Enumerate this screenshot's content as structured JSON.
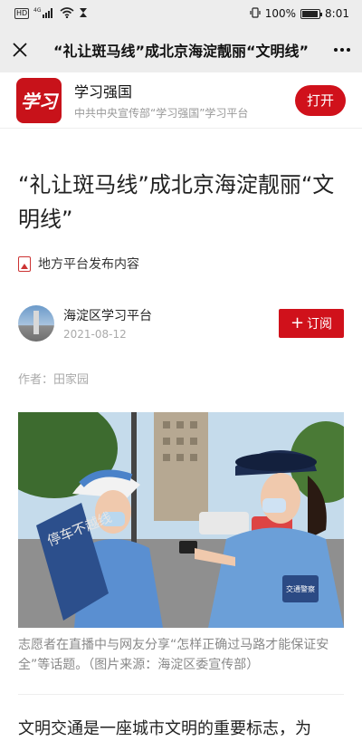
{
  "status_bar": {
    "left_badge": "HD",
    "signal_badge": "4G",
    "battery_percent": "100%",
    "time": "8:01"
  },
  "title_bar": {
    "title": "“礼让斑马线”成北京海淀靓丽“文明线”",
    "close_icon": "close-icon",
    "more_icon": "more-icon"
  },
  "app_banner": {
    "logo_text": "学习",
    "name": "学习强国",
    "description": "中共中央宣传部“学习强国”学习平台",
    "open_label": "打开",
    "brand_color": "#d0111b"
  },
  "article": {
    "title": "“礼让斑马线”成北京海淀靓丽“文明线”",
    "source_tag": "地方平台发布内容",
    "author": {
      "name": "海淀区学习平台",
      "date": "2021-08-12",
      "subscribe_label": "订阅"
    },
    "byline": "作者：田家园",
    "image": {
      "flag_text": "停车不越线",
      "badge_text": "交通警察"
    },
    "caption": "志愿者在直播中与网友分享“怎样正确过马路才能保证安全”等话题。（图片来源：海淀区委宣传部）",
    "body_first_line": "文明交通是一座城市文明的重要标志，为"
  }
}
